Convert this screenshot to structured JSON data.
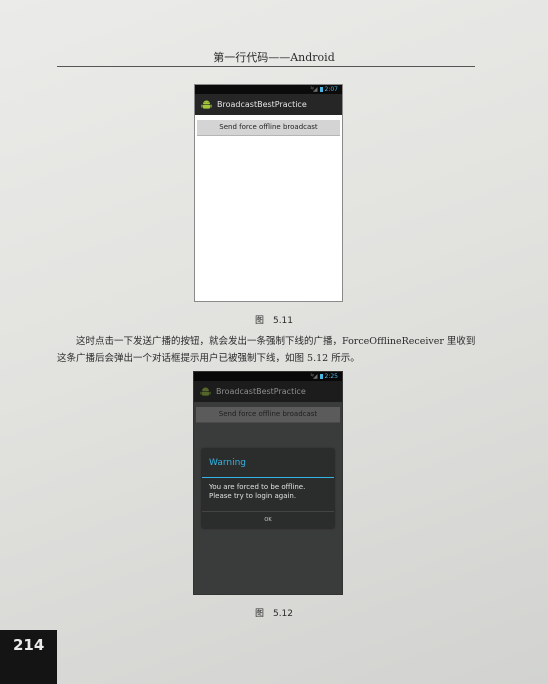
{
  "header": {
    "running_title": "第一行代码——Android"
  },
  "figure_1": {
    "status_signal": "³ᵍ◢",
    "status_time": "2:07",
    "app_title": "BroadcastBestPractice",
    "button_label": "Send force offline broadcast",
    "caption": "图　5.11"
  },
  "body": {
    "paragraph": "这时点击一下发送广播的按钮，就会发出一条强制下线的广播，ForceOfflineReceiver 里收到这条广播后会弹出一个对话框提示用户已被强制下线，如图 5.12 所示。"
  },
  "figure_2": {
    "status_signal": "³ᵍ◢",
    "status_time": "2:25",
    "app_title": "BroadcastBestPractice",
    "button_label": "Send force offline broadcast",
    "dialog_title": "Warning",
    "dialog_message_line1": "You are forced to be offline.",
    "dialog_message_line2": "Please try to login again.",
    "dialog_button": "OK",
    "caption": "图　5.12"
  },
  "footer": {
    "page_number": "214"
  },
  "colors": {
    "holo_blue": "#33b5e5",
    "page_tab": "#141414"
  },
  "icons": {
    "app_icon": "android-robot-icon"
  }
}
